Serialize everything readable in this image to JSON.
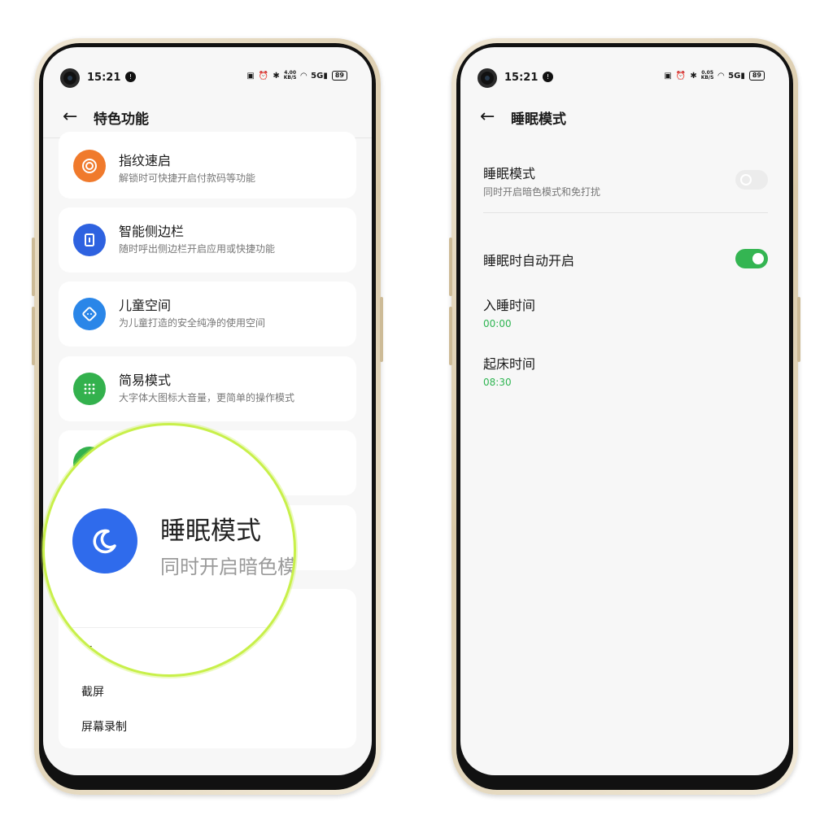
{
  "status_bar": {
    "time": "15:21",
    "notification": "!",
    "left_phone_speed": "4.00",
    "right_phone_speed": "0.05",
    "speed_unit": "KB/S",
    "network": "5G",
    "battery": "89"
  },
  "left_screen": {
    "header_title": "特色功能",
    "items": [
      {
        "title": "指纹速启",
        "desc": "解锁时可快捷开启付款码等功能",
        "color": "#f07a2c",
        "icon": "fingerprint-icon"
      },
      {
        "title": "智能侧边栏",
        "desc": "随时呼出侧边栏开启应用或快捷功能",
        "color": "#2e62e0",
        "icon": "sidebar-icon"
      },
      {
        "title": "儿童空间",
        "desc": "为儿童打造的安全纯净的使用空间",
        "color": "#2a86e8",
        "icon": "kids-icon"
      },
      {
        "title": "简易模式",
        "desc": "大字体大图标大音量，更简单的操作模式",
        "color": "#33b14d",
        "icon": "grid-icon"
      }
    ],
    "bottom_items": [
      "截屏",
      "屏幕录制"
    ],
    "magnifier": {
      "title": "睡眠模式",
      "desc": "同时开启暗色模",
      "partial_label": "手",
      "icon": "moon-icon",
      "color": "#2f6bec",
      "ring_color": "#c8f04a"
    }
  },
  "right_screen": {
    "header_title": "睡眠模式",
    "sleep_mode": {
      "title": "睡眠模式",
      "desc": "同时开启暗色模式和免打扰",
      "enabled": false
    },
    "auto_enable": {
      "title": "睡眠时自动开启",
      "enabled": true
    },
    "bedtime": {
      "title": "入睡时间",
      "value": "00:00"
    },
    "wake_time": {
      "title": "起床时间",
      "value": "08:30"
    },
    "accent_color": "#34b552"
  }
}
